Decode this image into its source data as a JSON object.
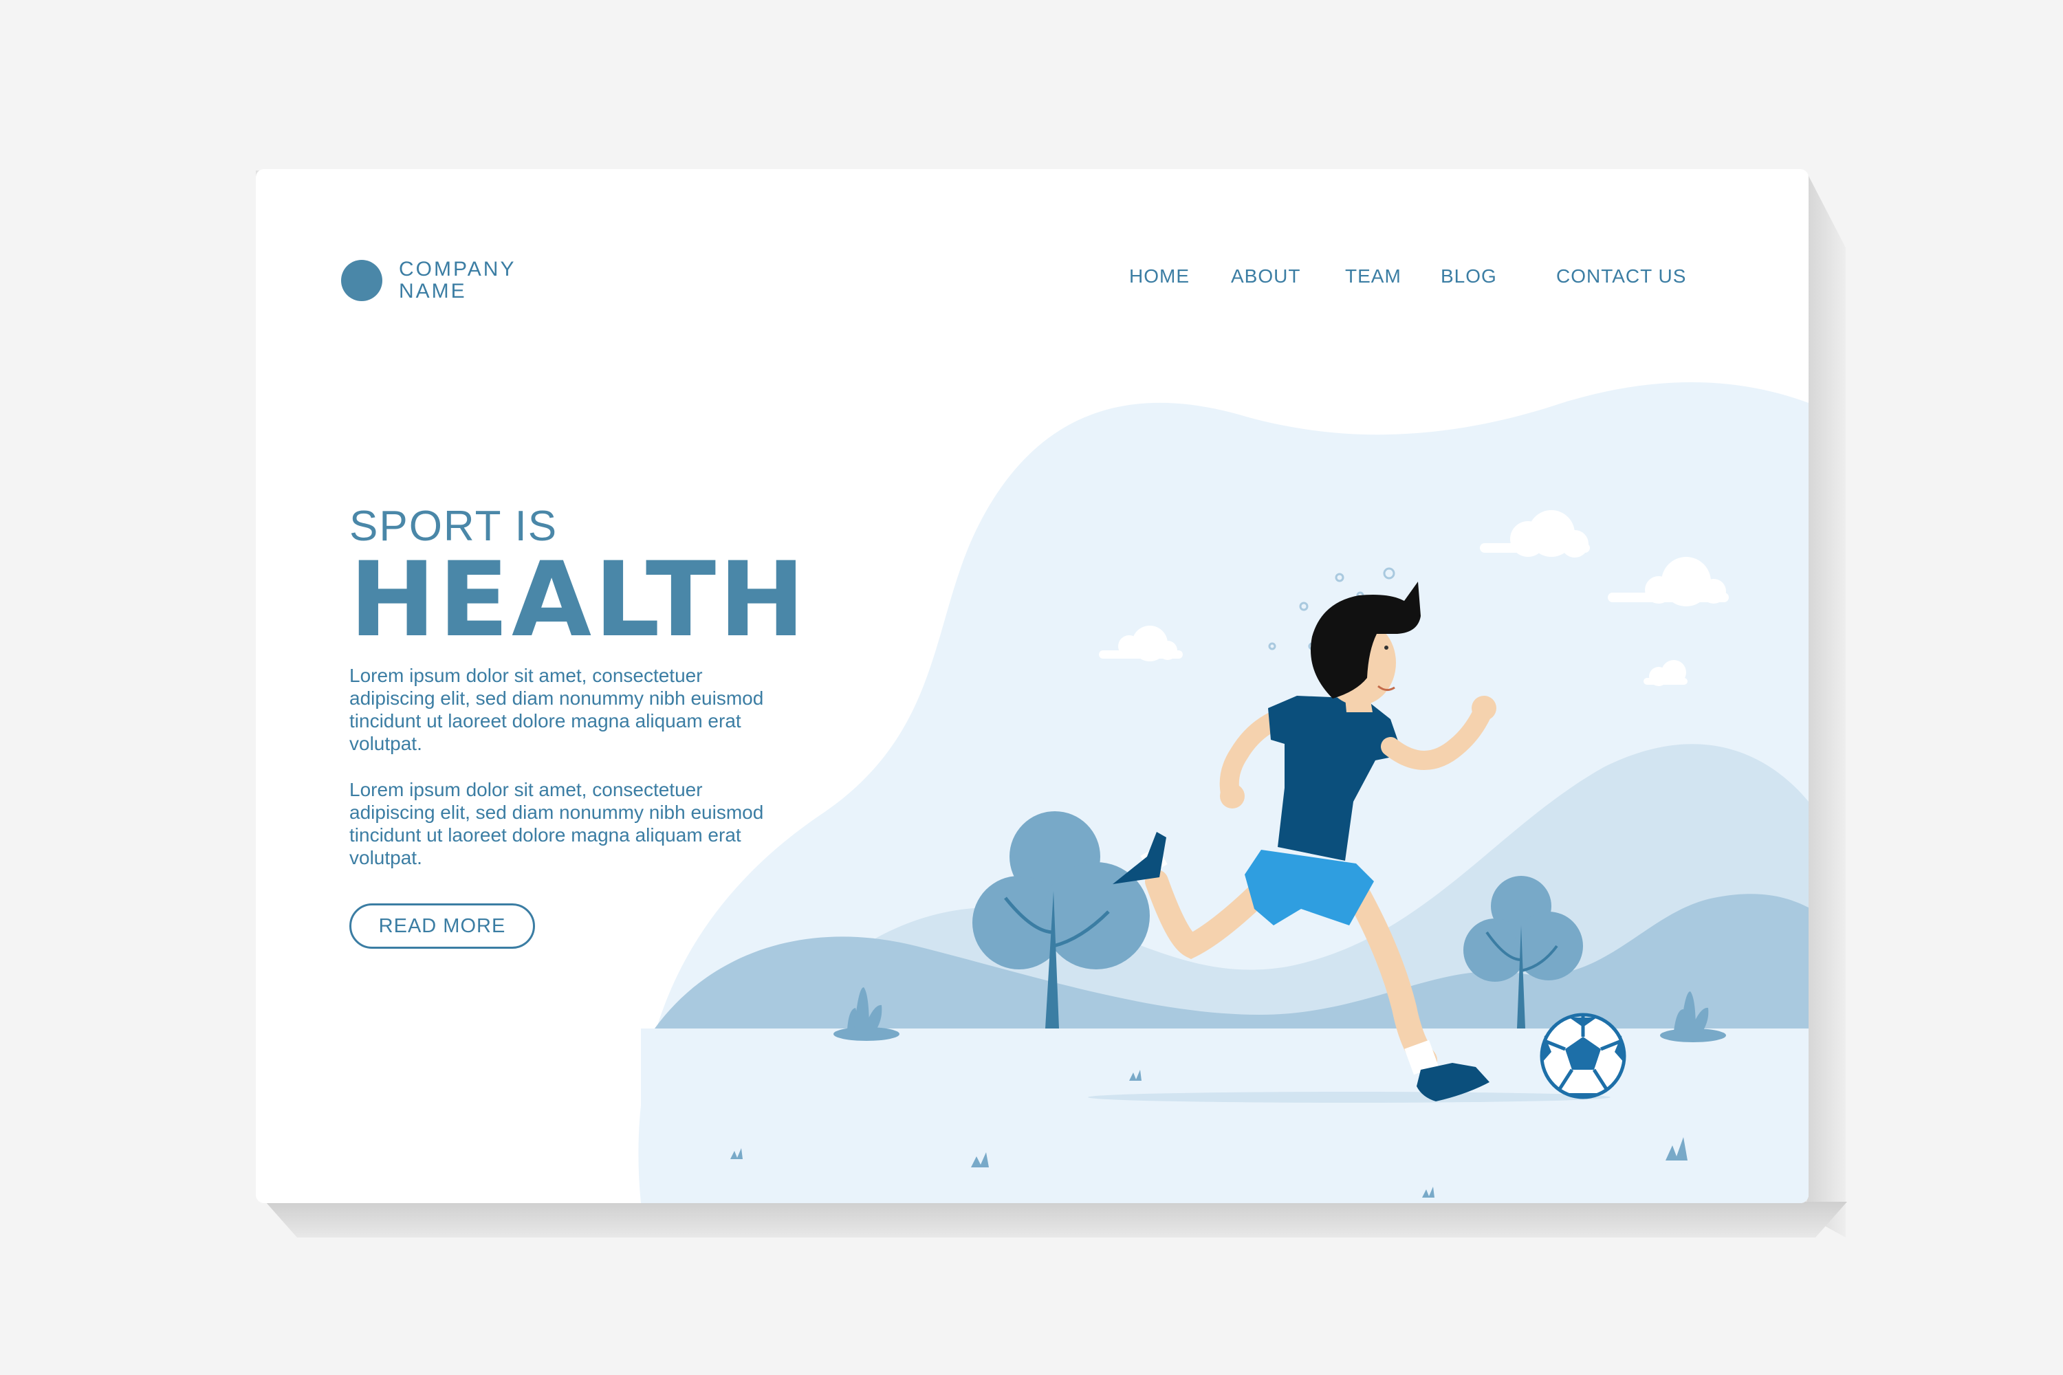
{
  "brand": {
    "line1": "COMPANY",
    "line2": "NAME"
  },
  "nav": {
    "items": [
      {
        "label": "HOME"
      },
      {
        "label": "ABOUT"
      },
      {
        "label": "TEAM"
      },
      {
        "label": "BLOG"
      },
      {
        "label": "CONTACT US"
      }
    ]
  },
  "hero": {
    "subtitle": "SPORT IS",
    "title": "HEALTH",
    "paragraph1": "Lorem ipsum dolor sit amet, consectetuer adipiscing elit, sed diam nonummy nibh euismod tincidunt ut laoreet dolore magna aliquam erat volutpat.",
    "paragraph2": "Lorem ipsum dolor sit amet, consectetuer adipiscing elit, sed diam nonummy nibh euismod tincidunt ut laoreet dolore magna aliquam erat volutpat.",
    "cta_label": "READ MORE"
  },
  "colors": {
    "accent": "#3b7da3",
    "blob": "#e9f3fb",
    "hill_light": "#d2e4f1",
    "hill_mid": "#a9c9df",
    "tree": "#78a9c8",
    "shirt": "#0b4f7c",
    "shorts": "#2f9ee0",
    "skin": "#f5d2ae"
  }
}
